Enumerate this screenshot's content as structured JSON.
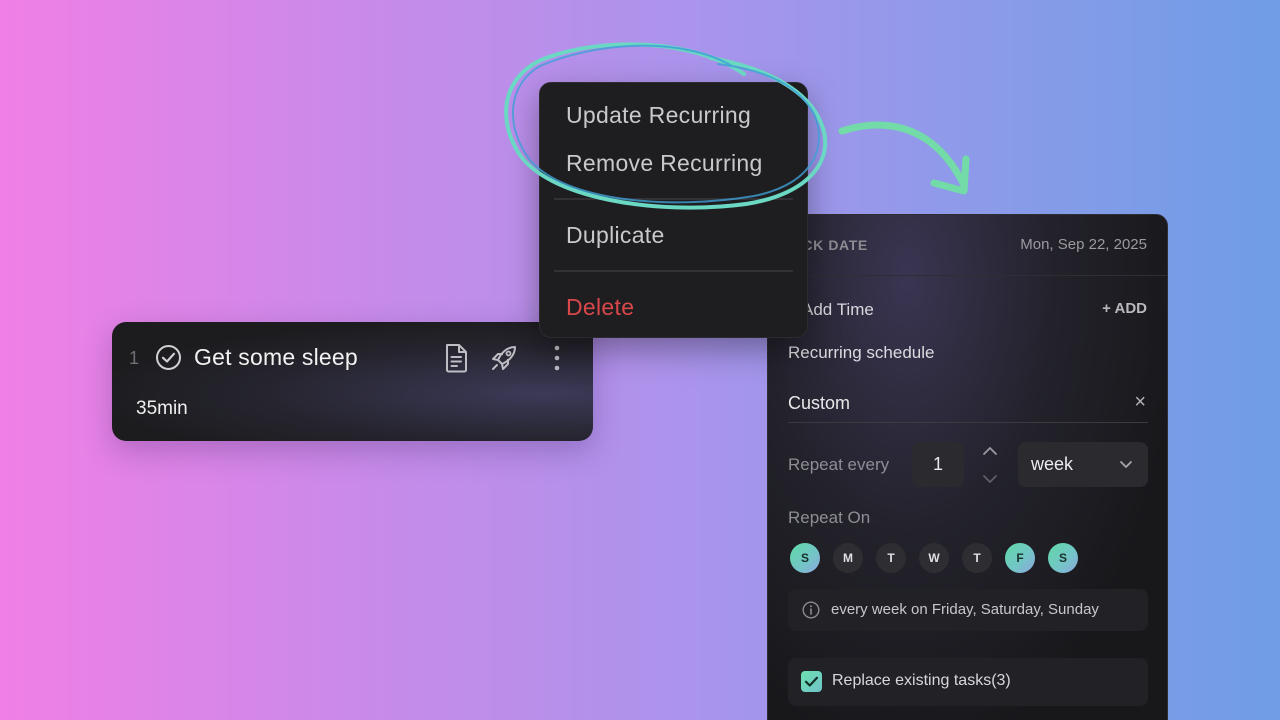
{
  "task": {
    "index": "1",
    "title": "Get some sleep",
    "duration": "35min"
  },
  "context_menu": {
    "items": [
      {
        "label": "Update Recurring"
      },
      {
        "label": "Remove Recurring"
      },
      {
        "label": "Duplicate"
      },
      {
        "label": "Delete"
      }
    ]
  },
  "panel": {
    "pick_date_label": "PICK DATE",
    "date": "Mon, Sep 22, 2025",
    "add_time_label": "Add Time",
    "add_button": "+ ADD",
    "recurring_label": "Recurring schedule",
    "custom_label": "Custom",
    "close_glyph": "×",
    "repeat_every_label": "Repeat every",
    "interval_value": "1",
    "unit_value": "week",
    "repeat_on_label": "Repeat On",
    "days": [
      {
        "letter": "S",
        "active": true
      },
      {
        "letter": "M",
        "active": false
      },
      {
        "letter": "T",
        "active": false
      },
      {
        "letter": "W",
        "active": false
      },
      {
        "letter": "T",
        "active": false
      },
      {
        "letter": "F",
        "active": true
      },
      {
        "letter": "S",
        "active": true
      }
    ],
    "summary": "every week on Friday, Saturday, Sunday",
    "replace_label": "Replace existing tasks(3)",
    "replace_checked": true
  },
  "colors": {
    "accent": "#5fd9a6",
    "delete": "#d9474a",
    "scribble": "#66d6c4"
  }
}
